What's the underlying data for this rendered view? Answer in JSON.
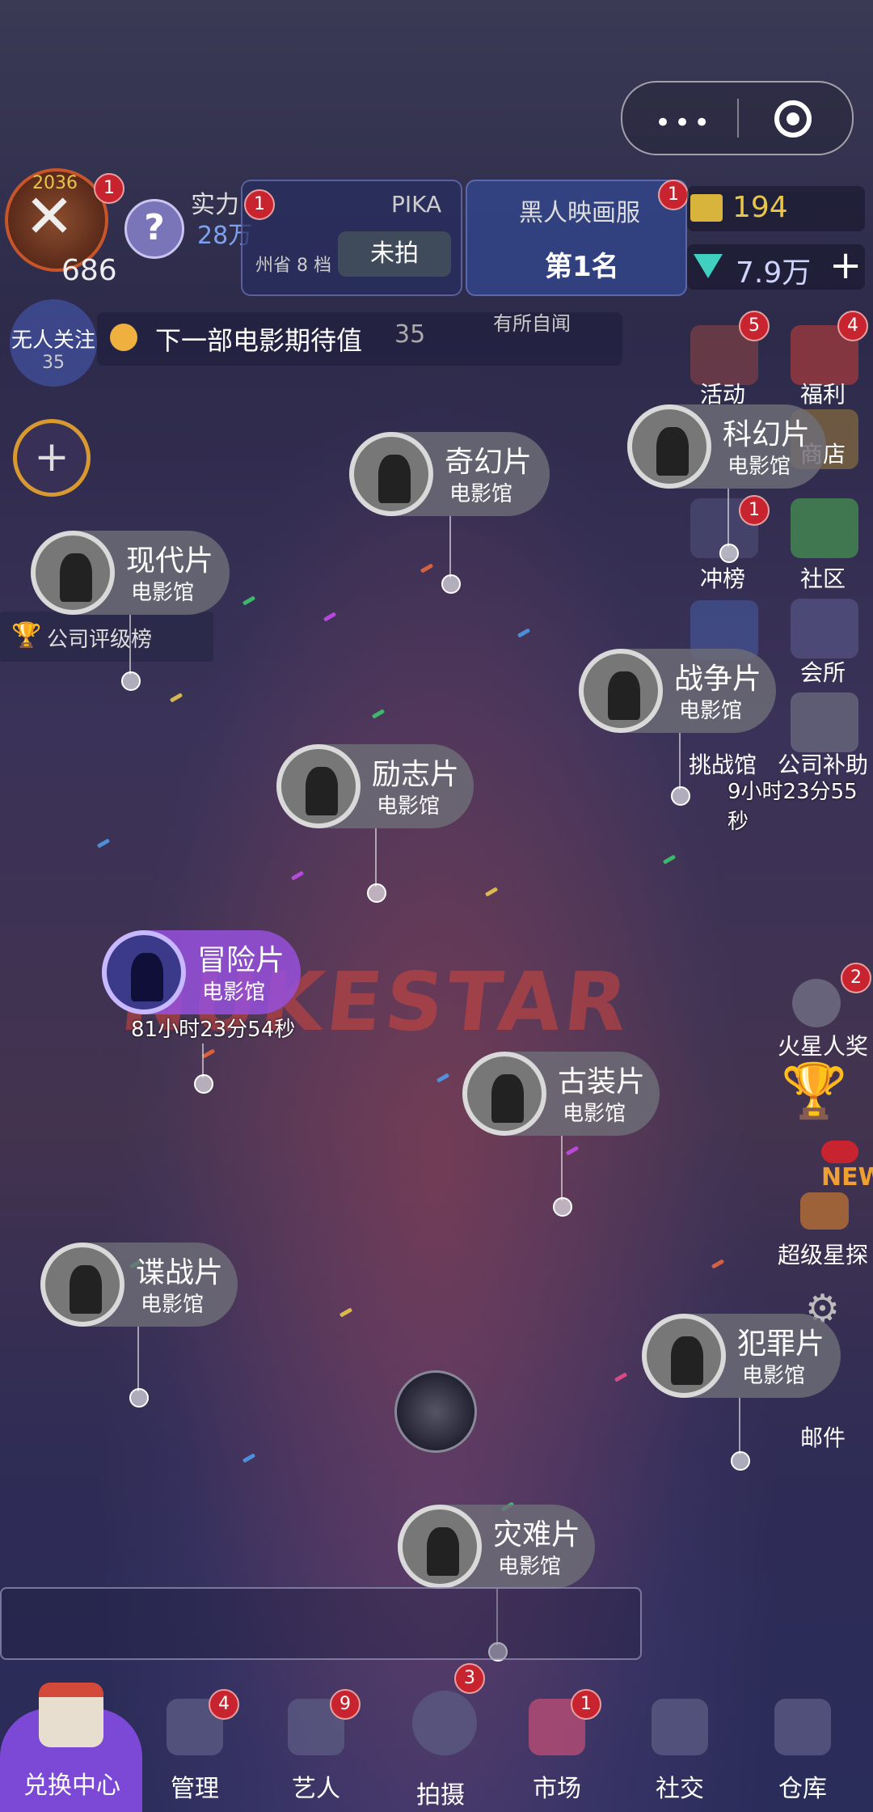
{
  "capsule": {
    "menu_icon": "more-dots-icon",
    "target_icon": "record-ring-icon"
  },
  "player": {
    "level": "686",
    "year": "2036",
    "power_label": "实力",
    "power_value": "28万",
    "badge": "1"
  },
  "header": {
    "pika": {
      "name": "PIKA",
      "status": "未拍",
      "meta": "州省 8 档",
      "badge": "1"
    },
    "server": {
      "title": "黑人映画服",
      "rank": "第1名",
      "badge": "1"
    },
    "gold": "194",
    "diamond": "7.9万",
    "add_label": "+"
  },
  "watch": {
    "label": "无人关注",
    "value": "35"
  },
  "expect": {
    "label": "下一部电影期待值",
    "value": "35",
    "hint": "有所自闻"
  },
  "company_rating": "公司评级榜",
  "right_icons": [
    {
      "label": "活动",
      "badge": "5"
    },
    {
      "label": "福利",
      "badge": "4"
    },
    {
      "label": "商店"
    },
    {
      "label": "冲榜",
      "badge": "1"
    },
    {
      "label": "社区"
    },
    {
      "label": "会所"
    },
    {
      "label": "挑战馆"
    },
    {
      "label": "公司补助",
      "timer": "9小时23分55秒"
    },
    {
      "label": "火星人奖",
      "badge": "2"
    },
    {
      "label": "超级星探",
      "tag": "NEW"
    },
    {
      "label": "邮件"
    }
  ],
  "halls": [
    {
      "name": "奇幻片",
      "sub": "电影馆"
    },
    {
      "name": "科幻片",
      "sub": "电影馆"
    },
    {
      "name": "现代片",
      "sub": "电影馆"
    },
    {
      "name": "战争片",
      "sub": "电影馆"
    },
    {
      "name": "励志片",
      "sub": "电影馆"
    },
    {
      "name": "冒险片",
      "sub": "电影馆",
      "timer": "81小时23分54秒"
    },
    {
      "name": "古装片",
      "sub": "电影馆"
    },
    {
      "name": "谍战片",
      "sub": "电影馆"
    },
    {
      "name": "犯罪片",
      "sub": "电影馆"
    },
    {
      "name": "灾难片",
      "sub": "电影馆"
    }
  ],
  "add_button": "+",
  "nav": [
    {
      "label": "兑换中心"
    },
    {
      "label": "管理",
      "badge": "4"
    },
    {
      "label": "艺人",
      "badge": "9"
    },
    {
      "label": "拍摄",
      "badge": "3"
    },
    {
      "label": "市场",
      "badge": "1"
    },
    {
      "label": "社交"
    },
    {
      "label": "仓库"
    }
  ],
  "colors": {
    "exchange_bg": "#7c49d6",
    "badge_red": "#c8242f",
    "gold_text": "#e7c64a",
    "diamond_text": "#cfd4ff"
  }
}
